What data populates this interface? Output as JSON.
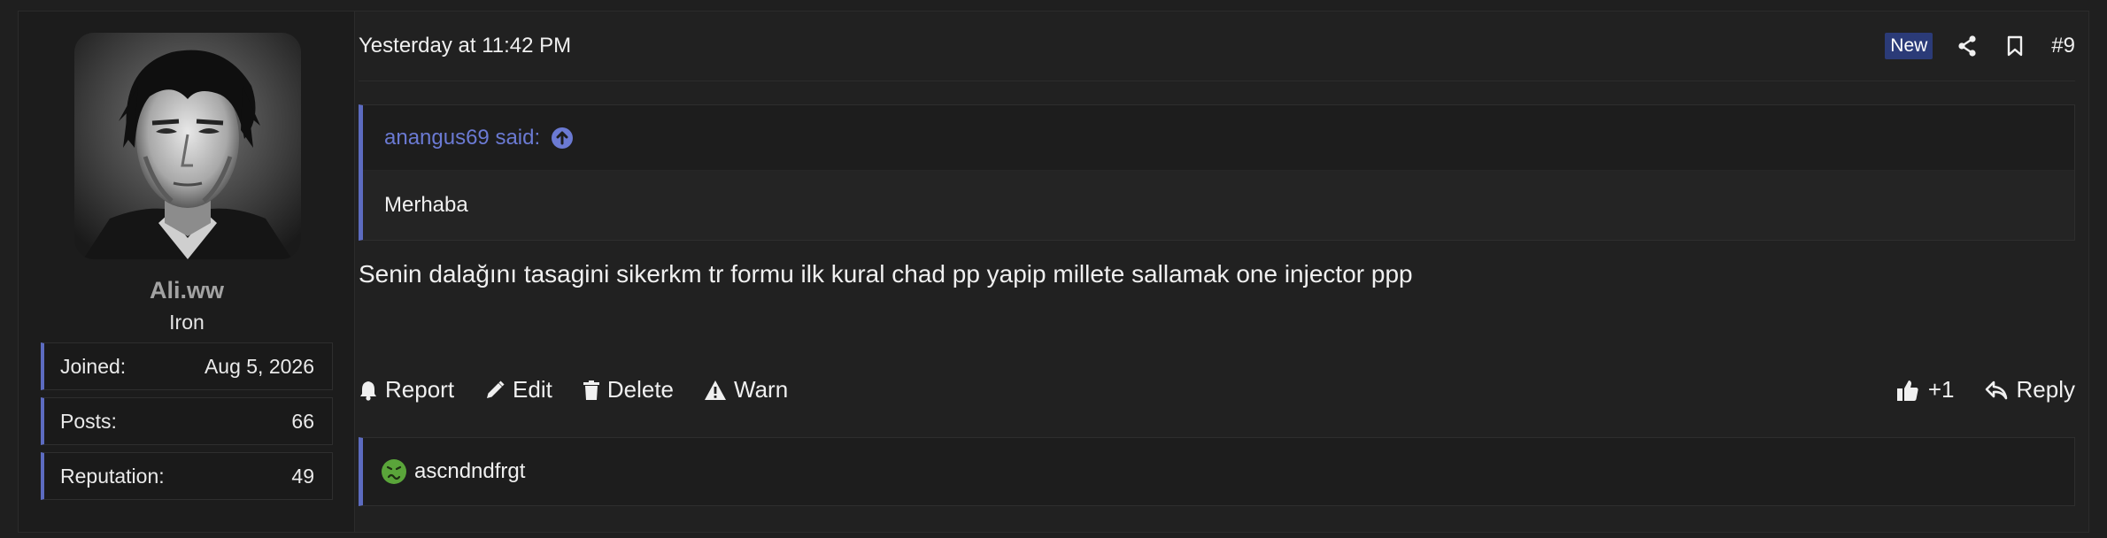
{
  "user": {
    "name": "Ali.ww",
    "title": "Iron",
    "stats": [
      {
        "label": "Joined:",
        "value": "Aug 5, 2026"
      },
      {
        "label": "Posts:",
        "value": "66"
      },
      {
        "label": "Reputation:",
        "value": "49"
      }
    ]
  },
  "post": {
    "timestamp": "Yesterday at 11:42 PM",
    "badge": "New",
    "number": "#9",
    "quote": {
      "author": "anangus69 said:",
      "text": "Merhaba"
    },
    "message": "Senin dalağını tasagini sikerkm tr formu ilk kural chad pp yapip millete sallamak one injector ppp"
  },
  "actions": {
    "report": "Report",
    "edit": "Edit",
    "delete": "Delete",
    "warn": "Warn",
    "like_count": "+1",
    "reply": "Reply"
  },
  "reactions": {
    "users": "ascndndfrgt"
  },
  "colors": {
    "accent": "#5c6bc0",
    "link": "#6b7ad3",
    "badge_bg": "#2b3b78",
    "reaction_emoji": "#5aa53a"
  },
  "icons": [
    "share-icon",
    "bookmark-icon",
    "arrow-up-circle-icon",
    "bell-icon",
    "pencil-icon",
    "trash-icon",
    "warning-icon",
    "thumbs-up-icon",
    "reply-icon",
    "sick-face-icon"
  ]
}
